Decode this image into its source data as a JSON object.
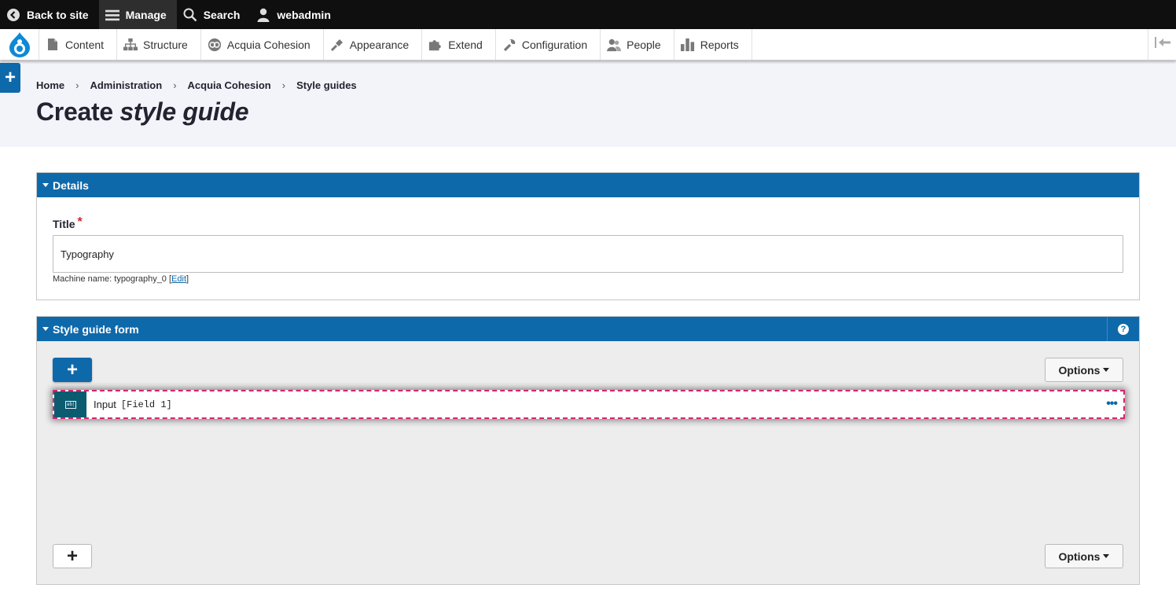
{
  "topbar": {
    "back_label": "Back to site",
    "manage_label": "Manage",
    "search_label": "Search",
    "user_label": "webadmin"
  },
  "tray": {
    "items": [
      {
        "label": "Content",
        "icon": "file-icon"
      },
      {
        "label": "Structure",
        "icon": "sitemap-icon"
      },
      {
        "label": "Acquia Cohesion",
        "icon": "cohesion-icon"
      },
      {
        "label": "Appearance",
        "icon": "paintbrush-icon"
      },
      {
        "label": "Extend",
        "icon": "puzzle-icon"
      },
      {
        "label": "Configuration",
        "icon": "wrench-icon"
      },
      {
        "label": "People",
        "icon": "people-icon"
      },
      {
        "label": "Reports",
        "icon": "bar-chart-icon"
      }
    ]
  },
  "breadcrumb": [
    "Home",
    "Administration",
    "Acquia Cohesion",
    "Style guides"
  ],
  "page_title": {
    "prefix": "Create",
    "emphasis": "style guide"
  },
  "details": {
    "heading": "Details",
    "title_label": "Title",
    "title_required": "*",
    "title_value": "Typography",
    "machine_name_prefix": "Machine name: typography_0 [",
    "machine_name_edit": "Edit",
    "machine_name_suffix": "]"
  },
  "style_guide_form": {
    "heading": "Style guide form",
    "help_label": "?",
    "add_label": "+",
    "options_label": "Options",
    "element": {
      "label": "Input",
      "field": "[Field 1]",
      "menu": "•••"
    }
  },
  "colors": {
    "accent": "#0e69ab",
    "element_icon_bg": "#0b5b71",
    "selection_outline": "#d6246e",
    "topbar_bg": "#0f0f0f"
  }
}
